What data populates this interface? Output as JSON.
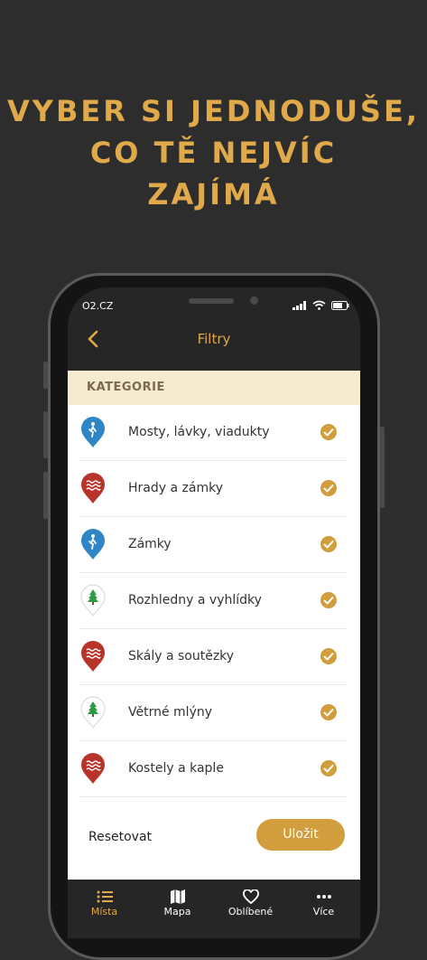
{
  "headline": [
    "VYBER SI JEDNODUŠE,",
    "CO TĚ NEJVÍC",
    "ZAJÍMÁ"
  ],
  "status": {
    "carrier": "O2.CZ"
  },
  "nav": {
    "title": "Filtry"
  },
  "section": {
    "title": "KATEGORIE"
  },
  "categories": [
    {
      "label": "Mosty, lávky, viadukty",
      "icon": "hiker-pin-icon",
      "color": "#2f86c6",
      "checked": true
    },
    {
      "label": "Hrady a zámky",
      "icon": "water-pin-icon",
      "color": "#b8332a",
      "checked": true
    },
    {
      "label": "Zámky",
      "icon": "hiker-pin-icon",
      "color": "#2f86c6",
      "checked": true
    },
    {
      "label": "Rozhledny a vyhlídky",
      "icon": "tree-pin-icon",
      "color": "#ffffff",
      "checked": true
    },
    {
      "label": "Skály a soutězky",
      "icon": "water-pin-icon",
      "color": "#b8332a",
      "checked": true
    },
    {
      "label": "Větrné mlýny",
      "icon": "tree-pin-icon",
      "color": "#ffffff",
      "checked": true
    },
    {
      "label": "Kostely a kaple",
      "icon": "water-pin-icon",
      "color": "#b8332a",
      "checked": true
    }
  ],
  "actions": {
    "reset_label": "Resetovat",
    "save_label": "Uložit"
  },
  "tabs": [
    {
      "label": "Místa",
      "icon": "list-icon",
      "active": true
    },
    {
      "label": "Mapa",
      "icon": "map-icon",
      "active": false
    },
    {
      "label": "Oblíbené",
      "icon": "heart-icon",
      "active": false
    },
    {
      "label": "Více",
      "icon": "more-icon",
      "active": false
    }
  ],
  "colors": {
    "accent": "#e0a94a",
    "button": "#d29d3d",
    "check": "#d29d3d",
    "background": "#2d2d2d",
    "section": "#f6ead0"
  }
}
